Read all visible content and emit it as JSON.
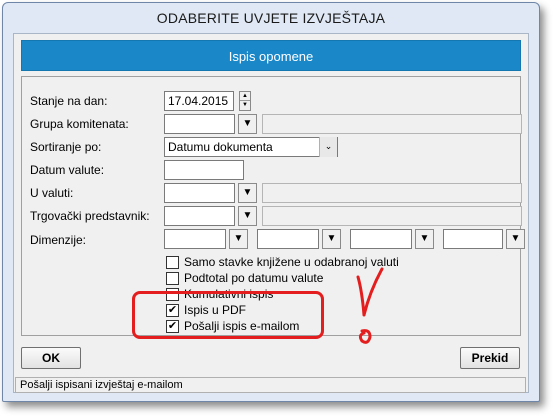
{
  "window": {
    "title": "ODABERITE UVJETE IZVJEŠTAJA"
  },
  "banner": "Ispis opomene",
  "fields": {
    "stanje": {
      "label": "Stanje na dan:",
      "value": "17.04.2015"
    },
    "grupa": {
      "label": "Grupa komitenata:"
    },
    "sortiranje": {
      "label": "Sortiranje po:",
      "value": "Datumu dokumenta"
    },
    "datum_valute": {
      "label": "Datum valute:"
    },
    "u_valuti": {
      "label": "U valuti:"
    },
    "trgovacki": {
      "label": "Trgovački predstavnik:"
    },
    "dimenzije": {
      "label": "Dimenzije:"
    }
  },
  "checkboxes": [
    {
      "label": "Samo stavke knjižene u odabranoj valuti",
      "checked": false
    },
    {
      "label": "Podtotal po datumu valute",
      "checked": false
    },
    {
      "label": "Kumulativni ispis",
      "checked": false
    },
    {
      "label": "Ispis u PDF",
      "checked": true
    },
    {
      "label": "Pošalji ispis e-mailom",
      "checked": true
    }
  ],
  "buttons": {
    "ok": "OK",
    "cancel": "Prekid"
  },
  "status": "Pošalji ispisani izvještaj e-mailom",
  "icons": {
    "dropdown": "▼",
    "combo": "⌄",
    "spin_up": "▲",
    "spin_down": "▼",
    "check": "✔"
  },
  "annotation_color": "#e41e1e"
}
